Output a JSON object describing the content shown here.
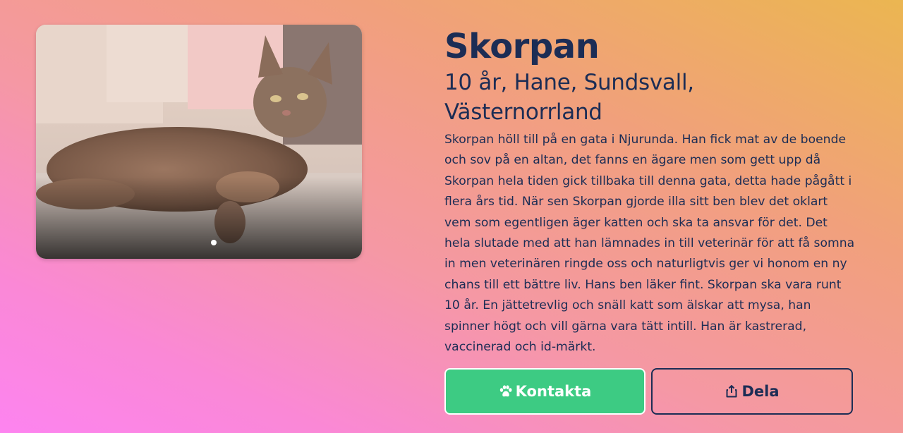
{
  "pet": {
    "name": "Skorpan",
    "meta": "10 år, Hane, Sundsvall, Västernorrland",
    "description": "Skorpan höll till på en gata i Njurunda. Han fick mat av de boende och sov på en altan, det fanns en ägare men som gett upp då Skorpan hela tiden gick tillbaka till denna gata, detta hade pågått i flera års tid. När sen Skorpan gjorde illa sitt ben blev det oklart vem som egentligen äger katten och ska ta ansvar för det. Det hela slutade med att han lämnades in till veterinär för att få somna in men veterinären ringde oss och naturligtvis ger vi honom en ny chans till ett bättre liv. Hans ben läker fint. Skorpan ska vara runt 10 år. En jättetrevlig och snäll katt som älskar att mysa, han spinner högt och vill gärna vara tätt intill. Han är kastrerad, vaccinerad och id-märkt."
  },
  "gallery": {
    "slide_count": 1,
    "active_slide": 1
  },
  "actions": {
    "contact_label": "Kontakta",
    "contact_icon": "paw-icon",
    "share_label": "Dela",
    "share_icon": "share-icon"
  },
  "colors": {
    "text": "#1c2d55",
    "contact_button": "#3dcb83",
    "background_gradient": [
      "#ebb651",
      "#f598a4",
      "#fd84f0"
    ]
  }
}
